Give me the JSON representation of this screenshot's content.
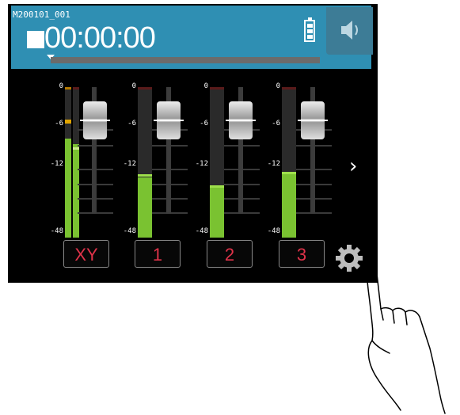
{
  "header": {
    "filename": "M200101_001",
    "timecode": "00:00:00",
    "battery": "full",
    "progress": 0
  },
  "scale": {
    "top": "0",
    "m6": "-6",
    "m12": "-12",
    "m48": "-48"
  },
  "channels": [
    {
      "label": "XY",
      "levels": [
        0.66,
        0.62
      ],
      "peaks": [
        0.78,
        0.6
      ],
      "fader_db": 0
    },
    {
      "label": "1",
      "level": 0.4,
      "peak": 0.4,
      "fader_db": 0
    },
    {
      "label": "2",
      "level": 0.33,
      "peak": 0.33,
      "fader_db": 0
    },
    {
      "label": "3",
      "level": 0.42,
      "peak": 0.42,
      "fader_db": 0
    }
  ],
  "icons": {
    "stop": "stop-icon",
    "battery": "battery-icon",
    "speaker": "speaker-icon",
    "next": "chevron-right-icon",
    "settings": "gear-icon",
    "hand": "hand-pointer-icon"
  },
  "colors": {
    "header_bg": "#2f8fb3",
    "meter_green": "#7ac231",
    "channel_label": "#e0334a"
  }
}
